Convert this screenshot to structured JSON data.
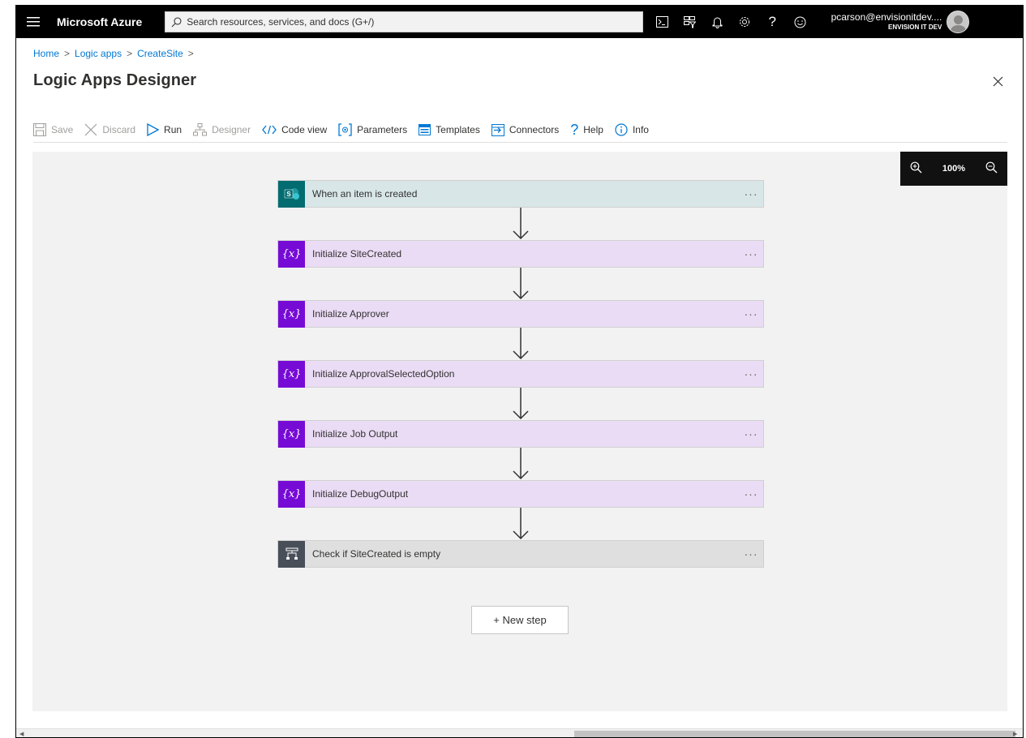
{
  "topbar": {
    "brand": "Microsoft Azure",
    "search_placeholder": "Search resources, services, and docs (G+/)",
    "account_email": "pcarson@envisionitdev....",
    "account_tenant": "ENVISION IT DEV",
    "icons": [
      "cloud-shell-icon",
      "directory-filter-icon",
      "notifications-icon",
      "settings-icon",
      "help-icon",
      "feedback-icon"
    ]
  },
  "breadcrumb": {
    "items": [
      "Home",
      "Logic apps",
      "CreateSite"
    ],
    "separator": ">"
  },
  "page": {
    "title": "Logic Apps Designer"
  },
  "toolbar": {
    "save": "Save",
    "discard": "Discard",
    "run": "Run",
    "designer": "Designer",
    "code_view": "Code view",
    "parameters": "Parameters",
    "templates": "Templates",
    "connectors": "Connectors",
    "help": "Help",
    "info": "Info"
  },
  "zoom": {
    "level": "100%"
  },
  "steps": [
    {
      "label": "When an item is created",
      "kind": "trigger",
      "icon": "sharepoint-icon"
    },
    {
      "label": "Initialize SiteCreated",
      "kind": "variable",
      "icon": "variable-icon"
    },
    {
      "label": "Initialize Approver",
      "kind": "variable",
      "icon": "variable-icon"
    },
    {
      "label": "Initialize ApprovalSelectedOption",
      "kind": "variable",
      "icon": "variable-icon"
    },
    {
      "label": "Initialize Job Output",
      "kind": "variable",
      "icon": "variable-icon"
    },
    {
      "label": "Initialize DebugOutput",
      "kind": "variable",
      "icon": "variable-icon"
    },
    {
      "label": "Check if SiteCreated is empty",
      "kind": "control",
      "icon": "condition-icon"
    }
  ],
  "step_menu": "···",
  "new_step": "+ New step",
  "colors": {
    "trigger_bg": "#d8e6e8",
    "trigger_icon": "#036c70",
    "variable_bg": "#eadcf5",
    "variable_icon": "#770bd6",
    "control_bg": "#dfdfdf",
    "control_icon": "#484f58",
    "link": "#0078d4"
  }
}
